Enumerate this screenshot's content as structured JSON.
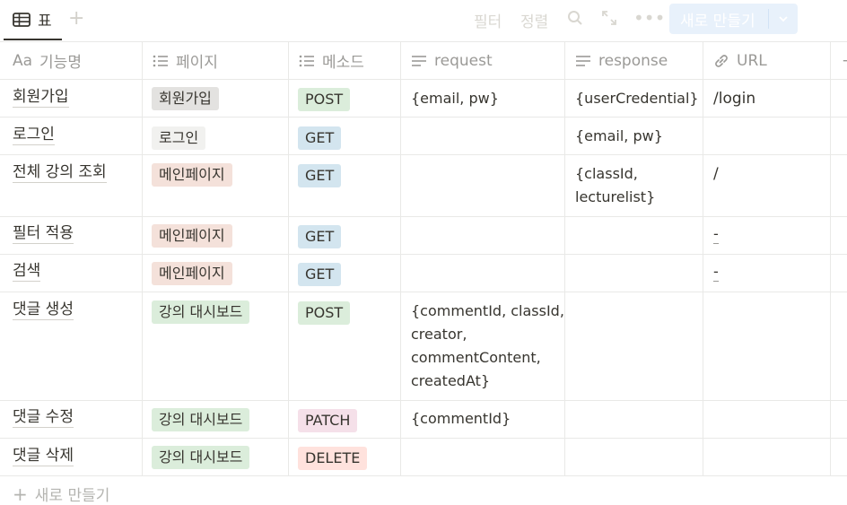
{
  "view": {
    "tab_label": "표"
  },
  "toolbar": {
    "filter": "필터",
    "sort": "정렬",
    "new_button": "새로 만들기"
  },
  "columns": [
    {
      "label": "기능명",
      "icon": "title-aa-icon"
    },
    {
      "label": "페이지",
      "icon": "list-icon"
    },
    {
      "label": "메소드",
      "icon": "list-icon"
    },
    {
      "label": "request",
      "icon": "text-lines-icon"
    },
    {
      "label": "response",
      "icon": "text-lines-icon"
    },
    {
      "label": "URL",
      "icon": "link-icon"
    }
  ],
  "rows": [
    {
      "name": "회원가입",
      "page": "회원가입",
      "method": "POST",
      "request": [
        "{email, pw}"
      ],
      "response": [
        "{userCredential}"
      ],
      "url": "/login"
    },
    {
      "name": "로그인",
      "page": "로그인",
      "method": "GET",
      "request": [],
      "response": [
        "{email, pw}"
      ],
      "url": ""
    },
    {
      "name": "전체 강의 조회",
      "page": "메인페이지",
      "method": "GET",
      "request": [],
      "response": [
        "{classId,",
        "lecturelist}"
      ],
      "url": "/"
    },
    {
      "name": "필터 적용",
      "page": "메인페이지",
      "method": "GET",
      "request": [],
      "response": [],
      "url": "-"
    },
    {
      "name": "검색",
      "page": "메인페이지",
      "method": "GET",
      "request": [],
      "response": [],
      "url": "-"
    },
    {
      "name": "댓글 생성",
      "page": "강의 대시보드",
      "method": "POST",
      "request": [
        "{commentId, classId,",
        "creator,",
        "commentContent,",
        "createdAt}"
      ],
      "response": [],
      "url": ""
    },
    {
      "name": "댓글 수정",
      "page": "강의 대시보드",
      "method": "PATCH",
      "request": [
        "{commentId}"
      ],
      "response": [],
      "url": ""
    },
    {
      "name": "댓글 삭제",
      "page": "강의 대시보드",
      "method": "DELETE",
      "request": [],
      "response": [],
      "url": ""
    }
  ],
  "new_row_label": "새로 만들기",
  "colors": {
    "page_gray": "#e3e2e0",
    "page_lightgray": "#f1f1ef",
    "page_brown": "#f4e1da",
    "page_green": "#dbeddb",
    "method_post": "#dbeddb",
    "method_get": "#d3e5ef",
    "method_patch": "#f5e0e9",
    "method_delete": "#ffe2dd"
  }
}
